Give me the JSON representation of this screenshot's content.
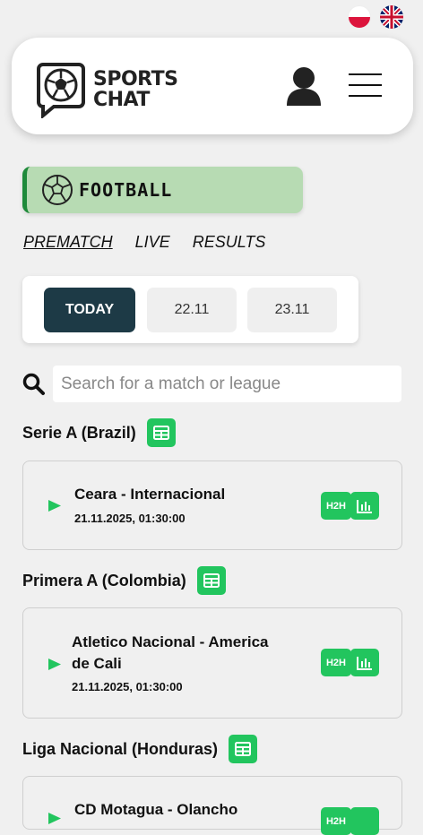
{
  "languages": [
    {
      "code": "pl",
      "icon": "flag-pl-icon"
    },
    {
      "code": "en",
      "icon": "flag-uk-icon"
    }
  ],
  "brand": {
    "line1": "SPORTS",
    "line2": "CHAT"
  },
  "sport": {
    "label": "FOOTBALL",
    "icon": "soccer-ball-icon"
  },
  "mode_tabs": [
    {
      "label": "PREMATCH",
      "active": true
    },
    {
      "label": "LIVE",
      "active": false
    },
    {
      "label": "RESULTS",
      "active": false
    }
  ],
  "dates": [
    {
      "label": "TODAY",
      "active": true
    },
    {
      "label": "22.11",
      "active": false
    },
    {
      "label": "23.11",
      "active": false
    }
  ],
  "search": {
    "placeholder": "Search for a match or league"
  },
  "leagues": [
    {
      "name": "Serie A (Brazil)",
      "match": {
        "title_line1": "Ceara - Internacional",
        "title_line2": "",
        "datetime": "21.11.2025, 01:30:00"
      }
    },
    {
      "name": "Primera A (Colombia)",
      "match": {
        "title_line1": "Atletico Nacional - America",
        "title_line2": "de Cali",
        "datetime": "21.11.2025, 01:30:00"
      }
    },
    {
      "name": "Liga Nacional (Honduras)",
      "match": {
        "title_line1": "CD Motagua - Olancho",
        "title_line2": "",
        "datetime": ""
      }
    }
  ],
  "buttons": {
    "h2h": "H2H"
  },
  "colors": {
    "accent_green": "#22c55e",
    "dark_navy": "#1d3a46",
    "badge_green": "#b7dbb3",
    "border_green": "#1e8a3a"
  }
}
